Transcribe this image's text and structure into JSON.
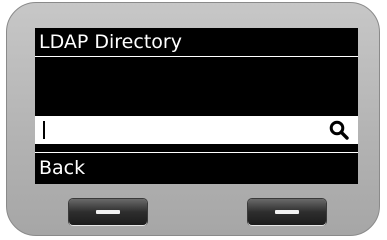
{
  "screen": {
    "title": "LDAP Directory",
    "search": {
      "value": "",
      "icon": "search-icon"
    },
    "softkey_label_left": "Back"
  },
  "colors": {
    "screen_bg": "#000000",
    "text": "#ffffff",
    "bezel": "#b4b4b4"
  }
}
